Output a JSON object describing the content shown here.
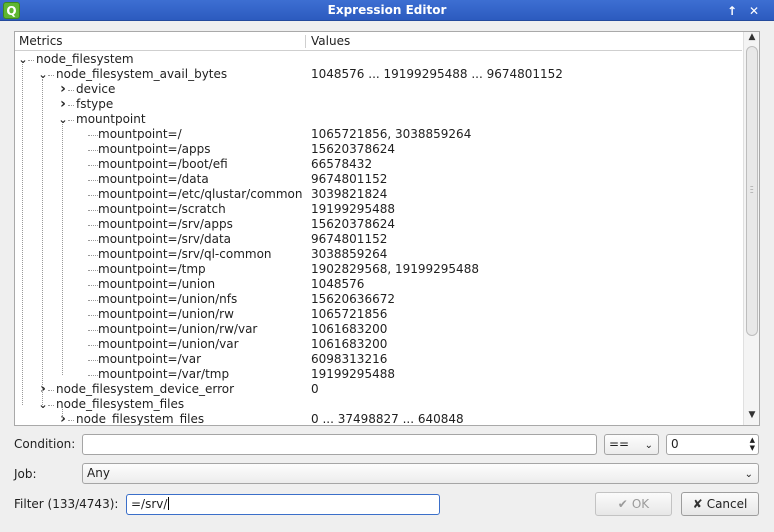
{
  "window": {
    "title": "Expression Editor",
    "app_icon_letter": "Q"
  },
  "tree": {
    "headers": {
      "metrics": "Metrics",
      "values": "Values"
    },
    "rows": [
      {
        "level": 0,
        "arrow": "down",
        "label": "node_filesystem",
        "value": ""
      },
      {
        "level": 1,
        "arrow": "down",
        "label": "node_filesystem_avail_bytes",
        "value": "1048576 ... 19199295488 ... 9674801152"
      },
      {
        "level": 2,
        "arrow": "right",
        "label": "device",
        "value": ""
      },
      {
        "level": 2,
        "arrow": "right",
        "label": "fstype",
        "value": ""
      },
      {
        "level": 2,
        "arrow": "down",
        "label": "mountpoint",
        "value": ""
      },
      {
        "level": 3,
        "arrow": "none",
        "label": "mountpoint=/",
        "value": "1065721856, 3038859264"
      },
      {
        "level": 3,
        "arrow": "none",
        "label": "mountpoint=/apps",
        "value": "15620378624"
      },
      {
        "level": 3,
        "arrow": "none",
        "label": "mountpoint=/boot/efi",
        "value": "66578432"
      },
      {
        "level": 3,
        "arrow": "none",
        "label": "mountpoint=/data",
        "value": "9674801152"
      },
      {
        "level": 3,
        "arrow": "none",
        "label": "mountpoint=/etc/qlustar/common",
        "value": "3039821824"
      },
      {
        "level": 3,
        "arrow": "none",
        "label": "mountpoint=/scratch",
        "value": "19199295488"
      },
      {
        "level": 3,
        "arrow": "none",
        "label": "mountpoint=/srv/apps",
        "value": "15620378624"
      },
      {
        "level": 3,
        "arrow": "none",
        "label": "mountpoint=/srv/data",
        "value": "9674801152"
      },
      {
        "level": 3,
        "arrow": "none",
        "label": "mountpoint=/srv/ql-common",
        "value": "3038859264"
      },
      {
        "level": 3,
        "arrow": "none",
        "label": "mountpoint=/tmp",
        "value": "1902829568, 19199295488"
      },
      {
        "level": 3,
        "arrow": "none",
        "label": "mountpoint=/union",
        "value": "1048576"
      },
      {
        "level": 3,
        "arrow": "none",
        "label": "mountpoint=/union/nfs",
        "value": "15620636672"
      },
      {
        "level": 3,
        "arrow": "none",
        "label": "mountpoint=/union/rw",
        "value": "1065721856"
      },
      {
        "level": 3,
        "arrow": "none",
        "label": "mountpoint=/union/rw/var",
        "value": "1061683200"
      },
      {
        "level": 3,
        "arrow": "none",
        "label": "mountpoint=/union/var",
        "value": "1061683200"
      },
      {
        "level": 3,
        "arrow": "none",
        "label": "mountpoint=/var",
        "value": "6098313216"
      },
      {
        "level": 3,
        "arrow": "none",
        "label": "mountpoint=/var/tmp",
        "value": "19199295488"
      },
      {
        "level": 1,
        "arrow": "right",
        "label": "node_filesystem_device_error",
        "value": "0"
      },
      {
        "level": 1,
        "arrow": "down",
        "label": "node_filesystem_files",
        "value": ""
      },
      {
        "level": 2,
        "arrow": "right",
        "label": "node_filesystem_files",
        "value": "0 ... 37498827 ... 640848"
      }
    ]
  },
  "condition": {
    "label": "Condition:",
    "value": "",
    "operator": "==",
    "number": "0"
  },
  "job": {
    "label": "Job:",
    "value": "Any"
  },
  "filter": {
    "label": "Filter (133/4743):",
    "value": "=/srv/"
  },
  "buttons": {
    "ok": "OK",
    "cancel": "Cancel"
  },
  "colors": {
    "titlebar": "#2c5bbf",
    "app_icon": "#5fb632"
  }
}
